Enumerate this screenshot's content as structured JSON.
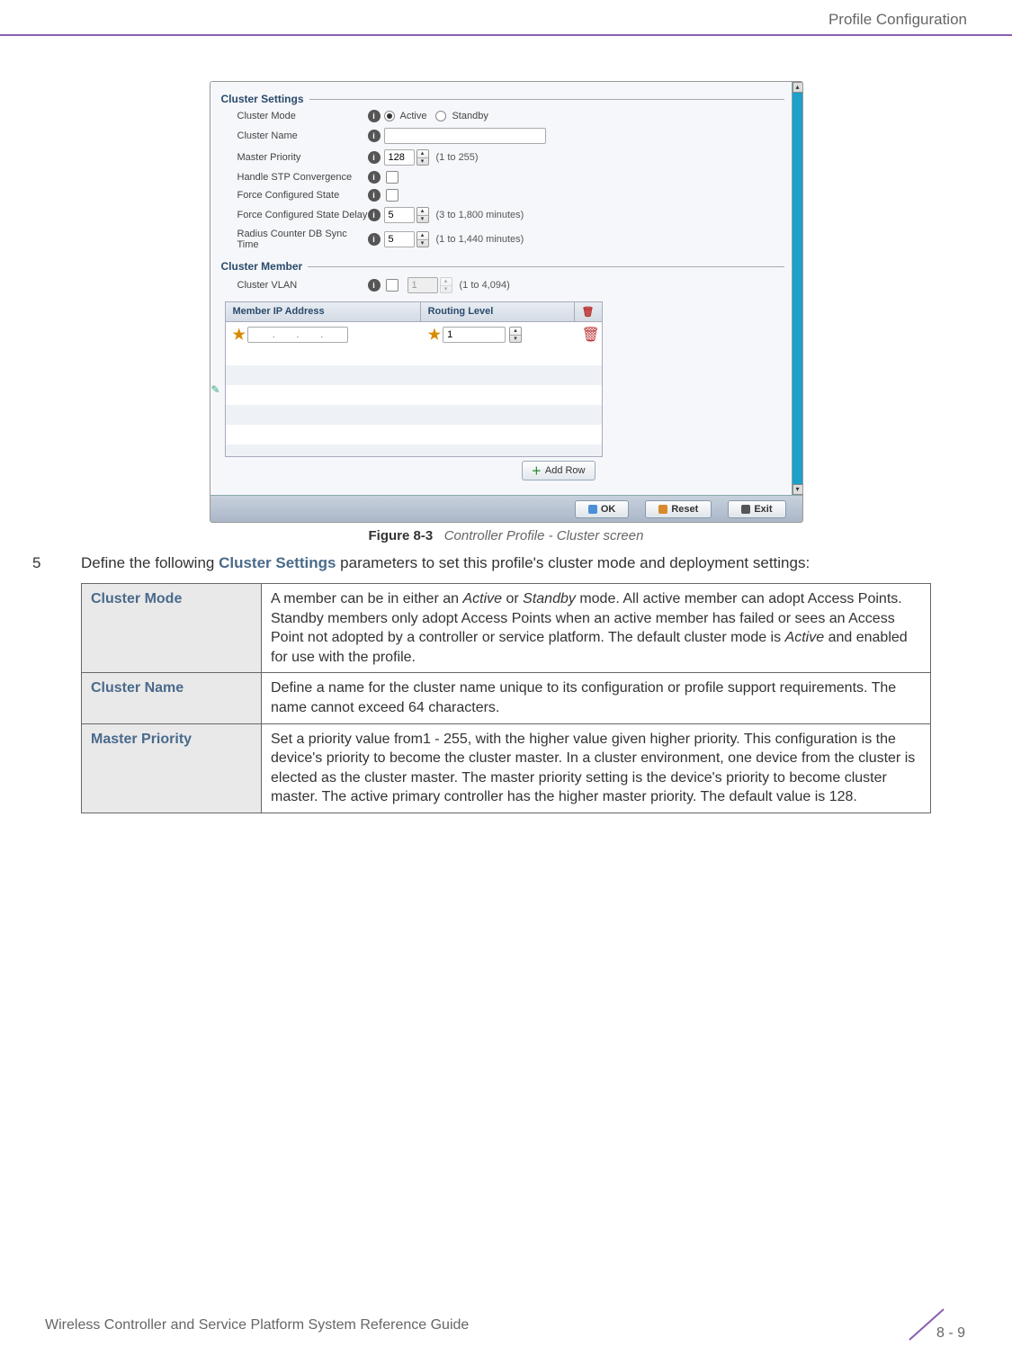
{
  "header": {
    "title": "Profile Configuration"
  },
  "screenshot": {
    "cluster_settings": {
      "legend": "Cluster Settings",
      "cluster_mode": {
        "label": "Cluster Mode",
        "active_label": "Active",
        "standby_label": "Standby",
        "selected": "Active"
      },
      "cluster_name": {
        "label": "Cluster Name",
        "value": ""
      },
      "master_priority": {
        "label": "Master Priority",
        "value": "128",
        "hint": "(1 to 255)"
      },
      "handle_stp": {
        "label": "Handle STP Convergence",
        "checked": false
      },
      "force_configured": {
        "label": "Force Configured State",
        "checked": false
      },
      "force_delay": {
        "label": "Force Configured State Delay",
        "value": "5",
        "hint": "(3 to 1,800 minutes)"
      },
      "radius_sync": {
        "label": "Radius Counter DB Sync Time",
        "value": "5",
        "hint": "(1 to 1,440 minutes)"
      }
    },
    "cluster_member": {
      "legend": "Cluster Member",
      "cluster_vlan": {
        "label": "Cluster VLAN",
        "value": "1",
        "hint": "(1 to 4,094)"
      },
      "columns": {
        "ip": "Member IP Address",
        "routing": "Routing Level"
      },
      "row": {
        "ip_parts": [
          "",
          "",
          "",
          ""
        ],
        "routing_level": "1"
      },
      "add_row_label": "Add Row"
    },
    "footer_buttons": {
      "ok": "OK",
      "reset": "Reset",
      "exit": "Exit"
    }
  },
  "figure_caption": {
    "label": "Figure 8-3",
    "desc": "Controller Profile - Cluster screen"
  },
  "step": {
    "number": "5",
    "text_before": "Define the following ",
    "bold_term": "Cluster Settings",
    "text_after": " parameters to set this profile's cluster mode and deployment settings:"
  },
  "settings_table": [
    {
      "term": "Cluster Mode",
      "def_html": "A member can be in either an <em>Active</em> or <em>Standby</em> mode. All active member can adopt Access Points. Standby members only adopt Access Points when an active member has failed or sees an Access Point not adopted by a controller or service platform. The default cluster mode is <em>Active</em> and enabled for use with the profile."
    },
    {
      "term": "Cluster Name",
      "def_html": "Define a name for the cluster name unique to its configuration or profile support requirements. The name cannot exceed 64 characters."
    },
    {
      "term": "Master Priority",
      "def_html": "Set a priority value from1 - 255, with the higher value given higher priority. This configuration is the device's priority to become the cluster master. In a cluster environment, one device from the cluster is elected as the cluster master. The master priority setting is the device's priority to become cluster master. The active primary controller has the higher master priority. The default value is 128."
    }
  ],
  "footer": {
    "doc_title": "Wireless Controller and Service Platform System Reference Guide",
    "page_num": "8 - 9"
  }
}
